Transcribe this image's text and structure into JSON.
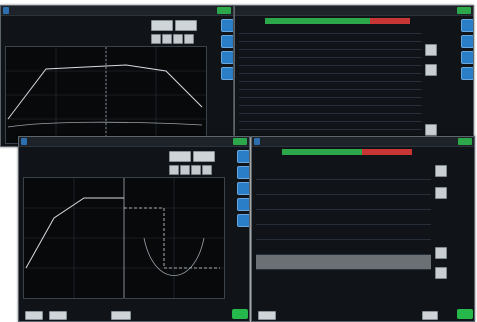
{
  "screens": [
    {
      "name": "screen-top-left"
    },
    {
      "name": "screen-top-right"
    },
    {
      "name": "screen-bottom-left"
    },
    {
      "name": "screen-bottom-right"
    }
  ],
  "colors": {
    "accent_blue": "#2a7ec8",
    "ok_green": "#27b84c",
    "header_green": "#2ca84a",
    "header_red": "#c73535",
    "trace_white": "#d9dde1",
    "grid": "#2a3138"
  },
  "icons": {
    "side_buttons": "square-blue-button",
    "scroll_up": "arrow-up-icon",
    "scroll_down": "arrow-down-icon",
    "nav_left": "arrow-left-icon",
    "nav_right": "arrow-right-icon"
  }
}
